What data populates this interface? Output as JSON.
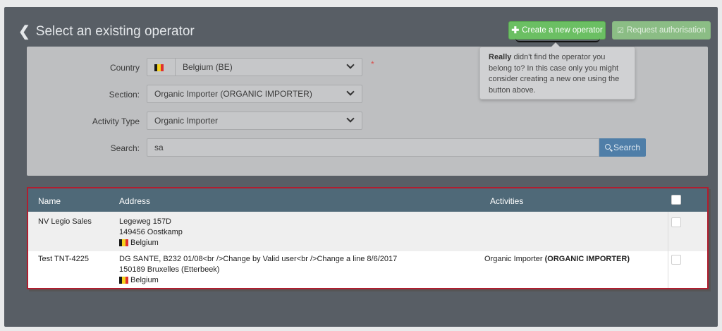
{
  "header": {
    "back_label": "Select an existing operator",
    "create_button": "Create a new operator",
    "request_button": "Request authorisation"
  },
  "form": {
    "country_label": "Country",
    "country_value": "Belgium (BE)",
    "required_mark": "*",
    "section_label": "Section:",
    "section_value": "Organic Importer (ORGANIC IMPORTER)",
    "activity_label": "Activity Type",
    "activity_value": "Organic Importer",
    "search_label": "Search:",
    "search_value": "sa",
    "search_button": "Search"
  },
  "tooltip": {
    "bold": "Really",
    "text": " didn't find the operator you belong to? In this case only you might consider creating a new one using the button above."
  },
  "table": {
    "headers": {
      "name": "Name",
      "address": "Address",
      "activities": "Activities"
    },
    "rows": [
      {
        "name": "NV Legio Sales",
        "address_line1": "Legeweg 157D",
        "address_line2": "149456 Oostkamp",
        "country": "Belgium",
        "activity": "",
        "activity_bold": ""
      },
      {
        "name": "Test TNT-4225",
        "address_line1": "DG SANTE, B232 01/08<br />Change by Valid user<br />Change a line 8/6/2017",
        "address_line2": "150189 Bruxelles (Etterbeek)",
        "country": "Belgium",
        "activity": "Organic Importer ",
        "activity_bold": "(ORGANIC IMPORTER)"
      }
    ]
  },
  "colors": {
    "frame": "#585e65",
    "create_green": "#6bbf63",
    "search_blue": "#4f7ea8",
    "table_header": "#4f6978",
    "highlight_red": "#b01e2f",
    "flag_black": "#1a1a1a",
    "flag_yellow": "#f4d21f",
    "flag_red": "#e0312e"
  },
  "icons": {
    "back": "chevron-left-icon",
    "create": "plus-icon",
    "request": "check-square-icon",
    "search": "magnifier-icon",
    "flag": "belgium-flag-icon",
    "dropdown": "chevron-down-icon",
    "cursor": "mouse-pointer-icon"
  }
}
